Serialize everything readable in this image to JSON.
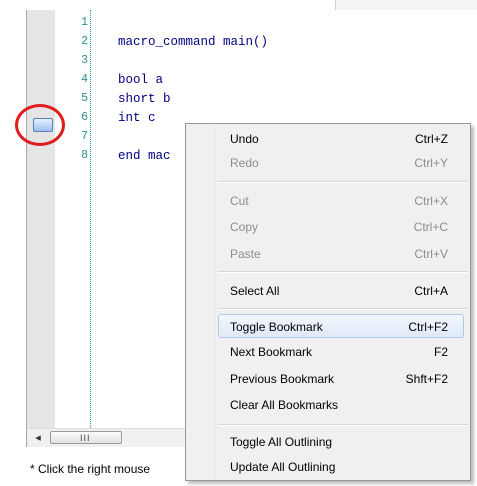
{
  "editor": {
    "line_numbers": [
      "1",
      "2",
      "3",
      "4",
      "5",
      "6",
      "7",
      "8"
    ],
    "code_lines": [
      "",
      "macro_command main()",
      "",
      "bool a",
      "short b",
      "int c",
      "",
      "end mac"
    ]
  },
  "scrollbar": {
    "left_arrow": "◂",
    "grip": "III"
  },
  "status": {
    "text": "* Click the right mouse"
  },
  "context_menu": {
    "items": [
      {
        "label": "Undo",
        "shortcut": "Ctrl+Z",
        "enabled": true
      },
      {
        "label": "Redo",
        "shortcut": "Ctrl+Y",
        "enabled": false
      },
      {
        "label": "Cut",
        "shortcut": "Ctrl+X",
        "enabled": false
      },
      {
        "label": "Copy",
        "shortcut": "Ctrl+C",
        "enabled": false
      },
      {
        "label": "Paste",
        "shortcut": "Ctrl+V",
        "enabled": false
      },
      {
        "label": "Select All",
        "shortcut": "Ctrl+A",
        "enabled": true
      },
      {
        "label": "Toggle Bookmark",
        "shortcut": "Ctrl+F2",
        "enabled": true,
        "highlighted": true
      },
      {
        "label": "Next Bookmark",
        "shortcut": "F2",
        "enabled": true
      },
      {
        "label": "Previous Bookmark",
        "shortcut": "Shft+F2",
        "enabled": true
      },
      {
        "label": "Clear All Bookmarks",
        "shortcut": "",
        "enabled": true
      },
      {
        "label": "Toggle All Outlining",
        "shortcut": "",
        "enabled": true
      },
      {
        "label": "Update All Outlining",
        "shortcut": "",
        "enabled": true
      }
    ]
  },
  "colors": {
    "highlight_ring": "#e01c1c",
    "code_text": "#000080",
    "line_number": "#2f8f8f"
  },
  "icons": {
    "bookmark": "bookmark-icon"
  }
}
